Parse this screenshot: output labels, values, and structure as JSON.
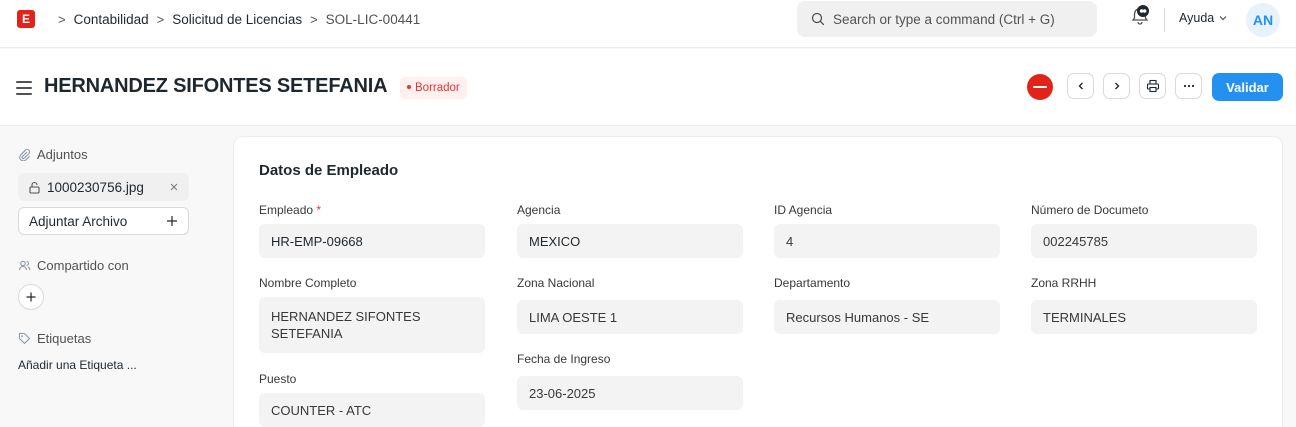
{
  "navbar": {
    "logo_letter": "E",
    "breadcrumbs": [
      "Contabilidad",
      "Solicitud de Licencias",
      "SOL-LIC-00441"
    ],
    "search_placeholder": "Search or type a command (Ctrl + G)",
    "help_label": "Ayuda",
    "avatar_initials": "AN"
  },
  "page": {
    "title": "HERNANDEZ SIFONTES SETEFANIA",
    "status": "Borrador",
    "primary_action": "Validar"
  },
  "sidebar": {
    "attachments_label": "Adjuntos",
    "attachment_file": "1000230756.jpg",
    "attach_button": "Adjuntar Archivo",
    "shared_label": "Compartido con",
    "tags_label": "Etiquetas",
    "add_tag": "Añadir una Etiqueta ..."
  },
  "form": {
    "section_title": "Datos de Empleado",
    "fields": {
      "empleado": {
        "label": "Empleado",
        "value": "HR-EMP-09668",
        "required": true
      },
      "nombre_completo": {
        "label": "Nombre Completo",
        "value": "HERNANDEZ SIFONTES SETEFANIA"
      },
      "puesto": {
        "label": "Puesto",
        "value": "COUNTER - ATC"
      },
      "agencia": {
        "label": "Agencia",
        "value": "MEXICO"
      },
      "zona_nacional": {
        "label": "Zona Nacional",
        "value": "LIMA OESTE 1"
      },
      "fecha_ingreso": {
        "label": "Fecha de Ingreso",
        "value": "23-06-2025"
      },
      "id_agencia": {
        "label": "ID Agencia",
        "value": "4"
      },
      "departamento": {
        "label": "Departamento",
        "value": "Recursos Humanos - SE"
      },
      "numero_documento": {
        "label": "Número de Documeto",
        "value": "002245785"
      },
      "zona_rrhh": {
        "label": "Zona RRHH",
        "value": "TERMINALES"
      }
    }
  },
  "colors": {
    "primary": "#2490ef",
    "brand_red": "#e2231a",
    "draft_badge": "#e03636"
  }
}
